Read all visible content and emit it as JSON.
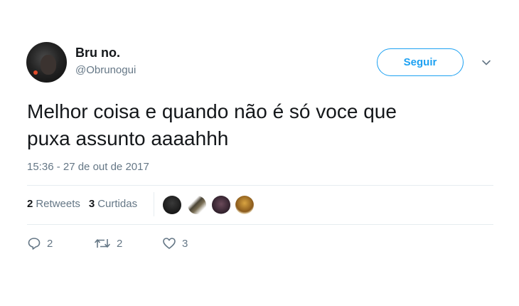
{
  "user": {
    "name": "Bru no.",
    "handle": "@Obrunogui"
  },
  "follow_label": "Seguir",
  "tweet": {
    "lines": [
      "Melhor coisa e quando não é só voce que",
      "puxa assunto aaaahhh"
    ],
    "timestamp": "15:36 - 27 de out de 2017"
  },
  "stats": {
    "retweets_count": "2",
    "retweets_label": "Retweets",
    "likes_count": "3",
    "likes_label": "Curtidas"
  },
  "actions": {
    "replies": "2",
    "retweets": "2",
    "likes": "3"
  },
  "icons": [
    "chevron-down-icon",
    "reply-icon",
    "retweet-icon",
    "heart-icon"
  ],
  "colors": {
    "accent": "#1da1f2",
    "secondary_text": "#657786",
    "divider": "#e6ecf0"
  }
}
